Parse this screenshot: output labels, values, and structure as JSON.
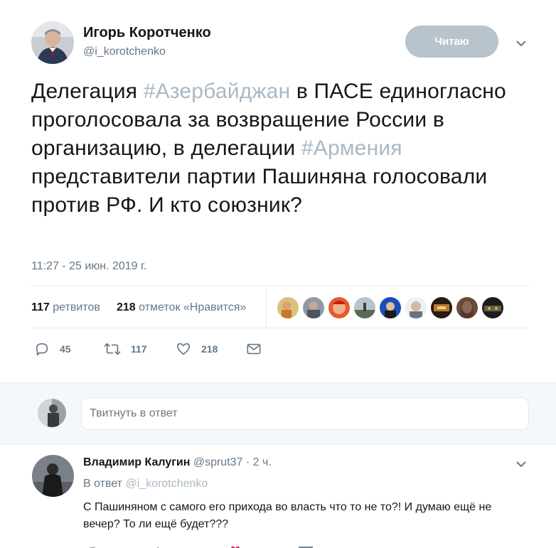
{
  "tweet": {
    "author_name": "Игорь Коротченко",
    "author_handle": "@i_korotchenko",
    "follow_label": "Читаю",
    "text_parts": {
      "p1": "Делегация ",
      "hashtag1": "#Азербайджан",
      "p2": " в ПАСЕ единогласно проголосовала за возвращение России в организацию, в делегации ",
      "hashtag2": "#Армения",
      "p3": " представители партии Пашиняна голосовали против РФ. И кто союзник?"
    },
    "timestamp": "11:27 - 25 июн. 2019 г.",
    "retweets_count": "117",
    "retweets_label": "ретвитов",
    "likes_count": "218",
    "likes_label": "отметок «Нравится»",
    "actions": {
      "reply_count": "45",
      "retweet_count": "117",
      "like_count": "218"
    },
    "colors": {
      "hashtag": "#aab8c2",
      "follow_button": "#b8c3cc",
      "secondary_text": "#657786"
    }
  },
  "reply_box": {
    "placeholder": "Твитнуть в ответ"
  },
  "reply": {
    "author_name": "Владимир Калугин",
    "author_handle": "@sprut37",
    "separator": " · ",
    "time": "2 ч.",
    "in_reply_prefix": "В ответ ",
    "in_reply_mention": "@i_korotchenko",
    "text": "С Пашиняном с самого его прихода во власть что то не то?! И думаю ещё не вечер? То ли ещё будет???"
  }
}
